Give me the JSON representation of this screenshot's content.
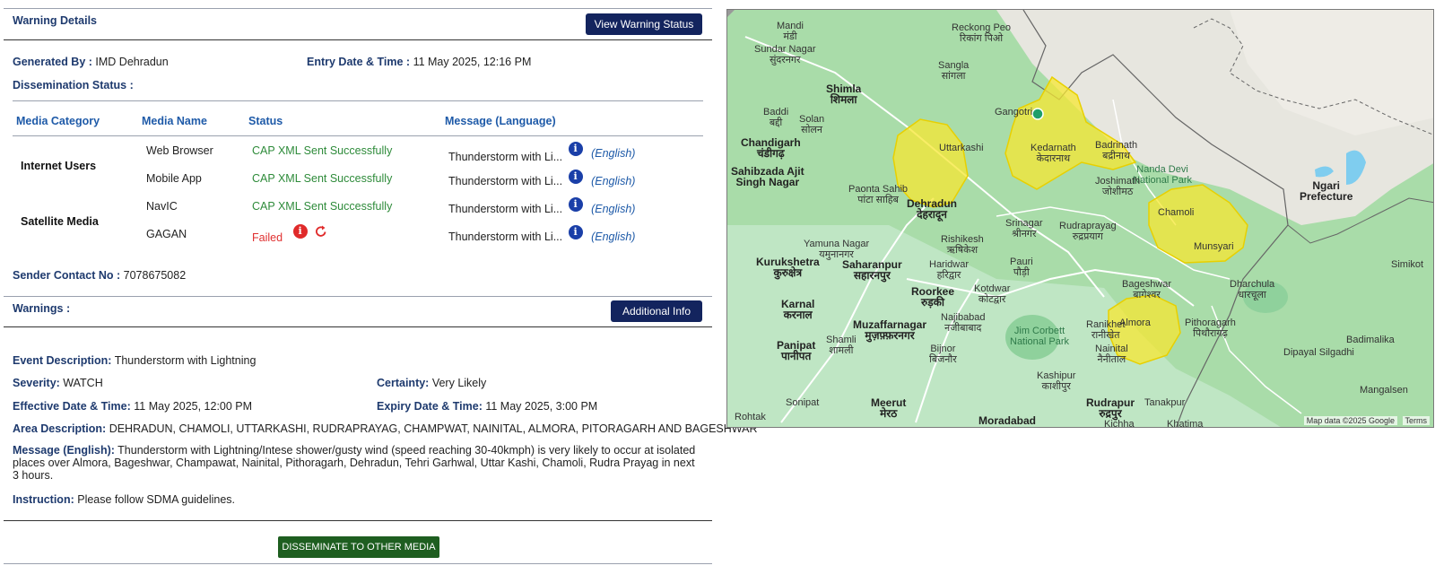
{
  "warning": {
    "section_title": "Warning Details",
    "view_status_button": "View Warning Status",
    "generated_by_label": "Generated By :",
    "generated_by_value": "IMD Dehradun",
    "entry_label": "Entry Date & Time :",
    "entry_value": "11 May 2025, 12:16 PM",
    "dissemination_label": "Dissemination Status :",
    "sender_label": "Sender Contact No :",
    "sender_value": "7078675082"
  },
  "table": {
    "headers": [
      "Media Category",
      "Media Name",
      "Status",
      "Message (Language)"
    ],
    "categories": [
      "Internet Users",
      "Satellite Media"
    ],
    "rows": [
      {
        "media": "Web Browser",
        "status": "CAP XML Sent Successfully",
        "message": "Thunderstorm with Li...",
        "language": "(English)"
      },
      {
        "media": "Mobile App",
        "status": "CAP XML Sent Successfully",
        "message": "Thunderstorm with Li...",
        "language": "(English)"
      },
      {
        "media": "NavIC",
        "status": "CAP XML Sent Successfully",
        "message": "Thunderstorm with Li...",
        "language": "(English)"
      },
      {
        "media": "GAGAN",
        "status": "Failed",
        "message": "Thunderstorm with Li...",
        "language": "(English)"
      }
    ],
    "status_colors": {
      "success": "#2e8b3a",
      "failed": "#e03030"
    }
  },
  "warnings": {
    "title": "Warnings :",
    "additional_info_button": "Additional Info",
    "event_label": "Event Description:",
    "event_value": "Thunderstorm with Lightning",
    "severity_label": "Severity:",
    "severity_value": "WATCH",
    "certainty_label": "Certainty:",
    "certainty_value": "Very Likely",
    "effective_label": "Effective Date & Time:",
    "effective_value": "11 May 2025, 12:00 PM",
    "expiry_label": "Expiry Date & Time:",
    "expiry_value": "11 May 2025, 3:00 PM",
    "area_label": "Area Description:",
    "area_value": "DEHRADUN, CHAMOLI, UTTARKASHI, RUDRAPRAYAG, CHAMPWAT, NAINITAL, ALMORA, PITORAGARH AND BAGESHWAR",
    "message_label": "Message (English):",
    "message_value": "Thunderstorm with Lightning/Intese shower/gusty wind (speed reaching 30-40kmph) is very likely to occur at isolated places over Almora, Bageshwar, Champawat, Nainital, Pithoragarh, Dehradun, Tehri Garhwal, Uttar Kashi, Chamoli, Rudra Prayag in next 3 hours.",
    "instruction_label": "Instruction:",
    "instruction_value": "Please follow SDMA guidelines.",
    "disseminate_button": "DISSEMINATE TO OTHER MEDIA"
  },
  "colors": {
    "navy": "#13245e",
    "header_blue": "#1e5aa8",
    "label_blue": "#1e3a6e",
    "disseminate_green": "#1e5e20"
  },
  "map": {
    "places": {
      "reckong_peo": "Reckong Peo",
      "reckong_peo_hi": "रिकांग पिओ",
      "sangla": "Sangla",
      "sangla_hi": "सांगला",
      "mandi": "Mandi",
      "mandi_hi": "मंडी",
      "sundar_nagar": "Sundar Nagar",
      "sundar_nagar_hi": "सुंदरनगर",
      "shimla": "Shimla",
      "shimla_hi": "शिमला",
      "solan": "Solan",
      "solan_hi": "सोलन",
      "baddi": "Baddi",
      "baddi_hi": "बद्दी",
      "chandigarh": "Chandigarh",
      "chandigarh_hi": "चंडीगढ़",
      "sahibzada": "Sahibzada Ajit",
      "singh_nagar": "Singh Nagar",
      "paonta": "Paonta Sahib",
      "paonta_hi": "पांटा साहिब",
      "dehradun": "Dehradun",
      "dehradun_hi": "देहरादून",
      "uttarkashi": "Uttarkashi",
      "gangotri": "Gangotri",
      "kedarnath": "Kedarnath",
      "kedarnath_hi": "केदारनाथ",
      "badrinath": "Badrinath",
      "badrinath_hi": "बद्रीनाथ",
      "nanda_devi": "Nanda Devi",
      "national_park": "National Park",
      "joshimath": "Joshimath",
      "joshimath_hi": "जोशीमठ",
      "ngari": "Ngari",
      "prefecture": "Prefecture",
      "chamoli": "Chamoli",
      "munsyari": "Munsyari",
      "yamuna_nagar": "Yamuna Nagar",
      "yamuna_nagar_hi": "यमुनानगर",
      "srinagar": "Srinagar",
      "srinagar_hi": "श्रीनगर",
      "rudraprayag": "Rudraprayag",
      "rudraprayag_hi": "रुद्रप्रयाग",
      "rishikesh": "Rishikesh",
      "rishikesh_hi": "ऋषिकेश",
      "haridwar": "Haridwar",
      "haridwar_hi": "हरिद्वार",
      "kurukshetra": "Kurukshetra",
      "kurukshetra_hi": "कुरुक्षेत्र",
      "saharanpur": "Saharanpur",
      "saharanpur_hi": "सहारनपुर",
      "pauri": "Pauri",
      "pauri_hi": "पौड़ी",
      "roorkee": "Roorkee",
      "roorkee_hi": "रुड़की",
      "kotdwar": "Kotdwar",
      "kotdwar_hi": "कोटद्वार",
      "bageshwar": "Bageshwar",
      "bageshwar_hi": "बागेश्वर",
      "dharchula": "Dharchula",
      "dharchula_hi": "धारचूला",
      "simikot": "Simikot",
      "karnal": "Karnal",
      "karnal_hi": "करनाल",
      "najibabad": "Najibabad",
      "najibabad_hi": "नजीबाबाद",
      "muzaffarnagar": "Muzaffarnagar",
      "muzaffarnagar_hi": "मुज़फ़्फ़रनगर",
      "jim_corbett": "Jim Corbett",
      "jim_corbett_np": "National Park",
      "ranikhet": "Ranikhet",
      "ranikhet_hi": "रानीखेत",
      "almora": "Almora",
      "pithoragarh": "Pithoragarh",
      "pithoragarh_hi": "पिथौरागढ़",
      "panipat": "Panipat",
      "panipat_hi": "पानीपत",
      "shamli": "Shamli",
      "shamli_hi": "शामली",
      "bijnor": "Bijnor",
      "bijnor_hi": "बिजनौर",
      "nainital": "Nainital",
      "nainital_hi": "नैनीताल",
      "badimalika": "Badimalika",
      "mangalsen": "Mangalsen",
      "dipayal": "Dipayal Silgadhi",
      "kashipur": "Kashipur",
      "kashipur_hi": "काशीपुर",
      "meerut": "Meerut",
      "meerut_hi": "मेरठ",
      "rudrapur": "Rudrapur",
      "rudrapur_hi": "रुद्रपुर",
      "tanakpur": "Tanakpur",
      "moradabad": "Moradabad",
      "sonipat": "Sonipat",
      "rohtak": "Rohtak",
      "kichha": "Kichha",
      "khatima": "Khatima"
    },
    "attribution": "Map data ©2025 Google",
    "terms": "Terms",
    "colors": {
      "land": "#a9dca9",
      "mountain": "#e6e6df",
      "plains": "#bfe6c4",
      "alert": "#f7e733",
      "road": "#ffffff",
      "border": "#666666"
    }
  }
}
